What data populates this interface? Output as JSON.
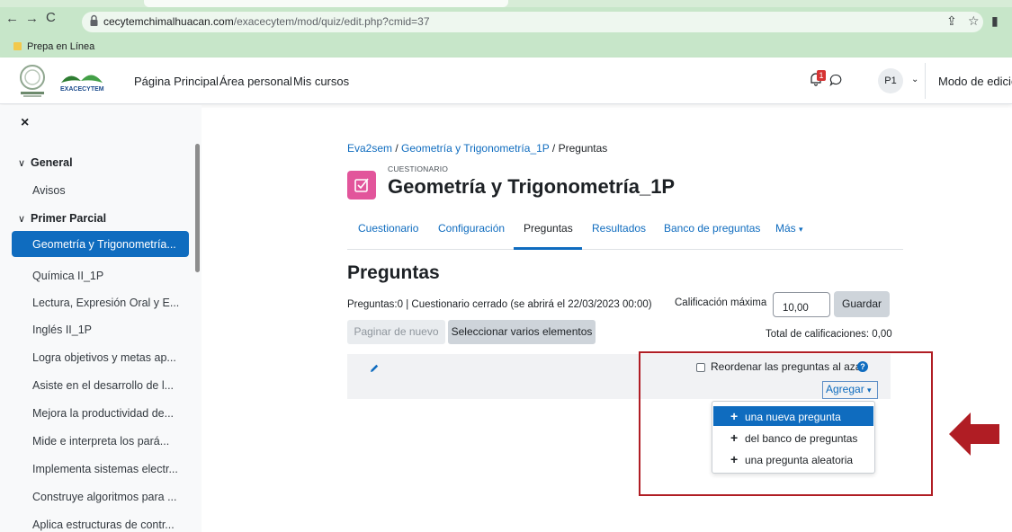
{
  "browser": {
    "url_host": "cecytemchimalhuacan.com",
    "url_path": "/exacecytem/mod/quiz/edit.php?cmid=37",
    "bookmark": "Prepa en Línea",
    "icons": [
      "back-icon",
      "forward-icon",
      "reload-icon",
      "lock-icon",
      "share-icon",
      "star-icon",
      "sidepanel-icon"
    ]
  },
  "navbar": {
    "links": [
      "Página Principal",
      "Área personal",
      "Mis cursos"
    ],
    "notification_count": "1",
    "avatar": "P1",
    "edit_mode": "Modo de edición"
  },
  "drawer": {
    "close": "×",
    "sections": [
      {
        "title": "General",
        "items": [
          "Avisos"
        ]
      },
      {
        "title": "Primer Parcial",
        "items": [
          "Geometría y Trigonometría...",
          "Química II_1P",
          "Lectura, Expresión Oral y E...",
          "Inglés II_1P",
          "Logra objetivos y metas ap...",
          "Asiste en el desarrollo de l...",
          "Mejora la productividad de...",
          "Mide e interpreta los pará...",
          "Implementa sistemas electr...",
          "Construye algoritmos para ...",
          "Aplica estructuras de contr..."
        ]
      }
    ],
    "active_item": "Geometría y Trigonometría..."
  },
  "breadcrumb": [
    "Eva2sem",
    "Geometría y Trigonometría_1P",
    "Preguntas"
  ],
  "quiz": {
    "kind": "CUESTIONARIO",
    "title": "Geometría y Trigonometría_1P"
  },
  "tabs": [
    "Cuestionario",
    "Configuración",
    "Preguntas",
    "Resultados",
    "Banco de preguntas",
    "Más"
  ],
  "active_tab": "Preguntas",
  "main": {
    "heading": "Preguntas",
    "info": "Preguntas:0 | Cuestionario cerrado (se abrirá el 22/03/2023 00:00)",
    "max_grade_label": "Calificación máxima",
    "max_grade_value": "10,00",
    "save": "Guardar",
    "repaginate": "Paginar de nuevo",
    "select_multiple": "Seleccionar varios elementos",
    "total": "Total de calificaciones: 0,00",
    "shuffle": "Reordenar las preguntas al azar",
    "add": "Agregar"
  },
  "add_menu": [
    "una nueva pregunta",
    "del banco de preguntas",
    "una pregunta aleatoria"
  ],
  "colors": {
    "primary": "#0f6cbf",
    "quiz_icon": "#e2559b",
    "annotation": "#b01d24",
    "browser_chrome": "#c7e6c9"
  }
}
